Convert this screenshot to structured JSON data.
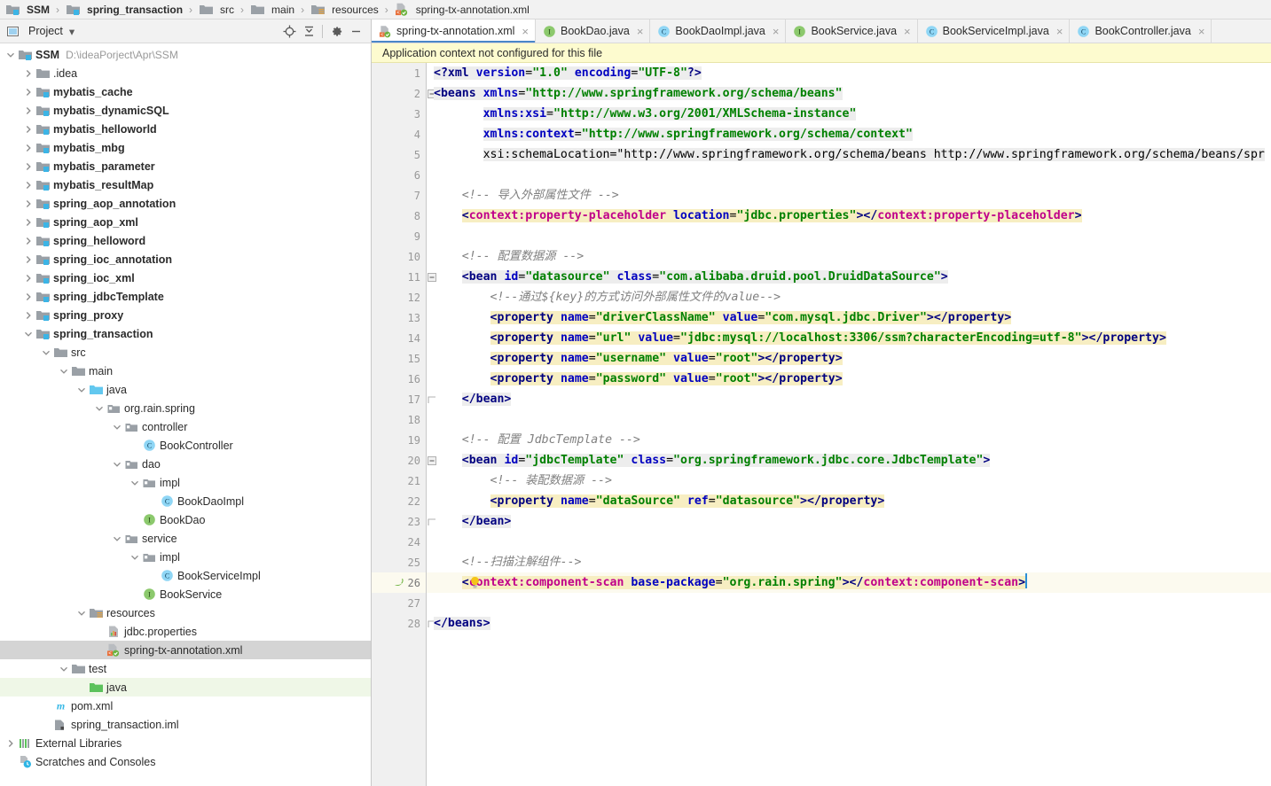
{
  "breadcrumb": {
    "items": [
      {
        "label": "SSM",
        "icon": "module-icon",
        "bold": true
      },
      {
        "label": "spring_transaction",
        "icon": "module-icon",
        "bold": true
      },
      {
        "label": "src",
        "icon": "folder-icon",
        "bold": false
      },
      {
        "label": "main",
        "icon": "folder-icon",
        "bold": false
      },
      {
        "label": "resources",
        "icon": "resources-folder-icon",
        "bold": false
      },
      {
        "label": "spring-tx-annotation.xml",
        "icon": "spring-xml-icon",
        "bold": false
      }
    ],
    "separator": "›"
  },
  "project_panel": {
    "title": "Project",
    "dropdown_caret": "▾",
    "toolbar_buttons": [
      {
        "name": "locate-icon",
        "tooltip": "Select Opened File"
      },
      {
        "name": "collapse-all-icon",
        "tooltip": "Collapse All"
      },
      {
        "name": "gear-icon",
        "tooltip": "Settings"
      },
      {
        "name": "minimize-icon",
        "tooltip": "Hide"
      }
    ],
    "tree": [
      {
        "indent": 0,
        "label": "SSM",
        "path": "D:\\ideaPorject\\Apr\\SSM",
        "icon": "module-icon",
        "arrow": "down",
        "bold": true
      },
      {
        "indent": 1,
        "label": ".idea",
        "icon": "folder-icon",
        "arrow": "right",
        "bold": false
      },
      {
        "indent": 1,
        "label": "mybatis_cache",
        "icon": "module-icon",
        "arrow": "right",
        "bold": true
      },
      {
        "indent": 1,
        "label": "mybatis_dynamicSQL",
        "icon": "module-icon",
        "arrow": "right",
        "bold": true
      },
      {
        "indent": 1,
        "label": "mybatis_helloworld",
        "icon": "module-icon",
        "arrow": "right",
        "bold": true
      },
      {
        "indent": 1,
        "label": "mybatis_mbg",
        "icon": "module-icon",
        "arrow": "right",
        "bold": true
      },
      {
        "indent": 1,
        "label": "mybatis_parameter",
        "icon": "module-icon",
        "arrow": "right",
        "bold": true
      },
      {
        "indent": 1,
        "label": "mybatis_resultMap",
        "icon": "module-icon",
        "arrow": "right",
        "bold": true
      },
      {
        "indent": 1,
        "label": "spring_aop_annotation",
        "icon": "module-icon",
        "arrow": "right",
        "bold": true
      },
      {
        "indent": 1,
        "label": "spring_aop_xml",
        "icon": "module-icon",
        "arrow": "right",
        "bold": true
      },
      {
        "indent": 1,
        "label": "spring_helloword",
        "icon": "module-icon",
        "arrow": "right",
        "bold": true
      },
      {
        "indent": 1,
        "label": "spring_ioc_annotation",
        "icon": "module-icon",
        "arrow": "right",
        "bold": true
      },
      {
        "indent": 1,
        "label": "spring_ioc_xml",
        "icon": "module-icon",
        "arrow": "right",
        "bold": true
      },
      {
        "indent": 1,
        "label": "spring_jdbcTemplate",
        "icon": "module-icon",
        "arrow": "right",
        "bold": true
      },
      {
        "indent": 1,
        "label": "spring_proxy",
        "icon": "module-icon",
        "arrow": "right",
        "bold": true
      },
      {
        "indent": 1,
        "label": "spring_transaction",
        "icon": "module-icon",
        "arrow": "down",
        "bold": true
      },
      {
        "indent": 2,
        "label": "src",
        "icon": "folder-icon",
        "arrow": "down",
        "bold": false
      },
      {
        "indent": 3,
        "label": "main",
        "icon": "folder-icon",
        "arrow": "down",
        "bold": false
      },
      {
        "indent": 4,
        "label": "java",
        "icon": "source-folder-icon",
        "arrow": "down",
        "bold": false
      },
      {
        "indent": 5,
        "label": "org.rain.spring",
        "icon": "package-icon",
        "arrow": "down",
        "bold": false
      },
      {
        "indent": 6,
        "label": "controller",
        "icon": "package-icon",
        "arrow": "down",
        "bold": false
      },
      {
        "indent": 7,
        "label": "BookController",
        "icon": "class-icon",
        "arrow": "none",
        "bold": false
      },
      {
        "indent": 6,
        "label": "dao",
        "icon": "package-icon",
        "arrow": "down",
        "bold": false
      },
      {
        "indent": 7,
        "label": "impl",
        "icon": "package-icon",
        "arrow": "down",
        "bold": false
      },
      {
        "indent": 8,
        "label": "BookDaoImpl",
        "icon": "class-icon",
        "arrow": "none",
        "bold": false
      },
      {
        "indent": 7,
        "label": "BookDao",
        "icon": "interface-icon",
        "arrow": "none",
        "bold": false
      },
      {
        "indent": 6,
        "label": "service",
        "icon": "package-icon",
        "arrow": "down",
        "bold": false
      },
      {
        "indent": 7,
        "label": "impl",
        "icon": "package-icon",
        "arrow": "down",
        "bold": false
      },
      {
        "indent": 8,
        "label": "BookServiceImpl",
        "icon": "class-icon",
        "arrow": "none",
        "bold": false
      },
      {
        "indent": 7,
        "label": "BookService",
        "icon": "interface-icon",
        "arrow": "none",
        "bold": false
      },
      {
        "indent": 4,
        "label": "resources",
        "icon": "resources-folder-icon",
        "arrow": "down",
        "bold": false
      },
      {
        "indent": 5,
        "label": "jdbc.properties",
        "icon": "properties-icon",
        "arrow": "none",
        "bold": false
      },
      {
        "indent": 5,
        "label": "spring-tx-annotation.xml",
        "icon": "spring-xml-icon",
        "arrow": "none",
        "bold": false,
        "state": "selected"
      },
      {
        "indent": 3,
        "label": "test",
        "icon": "folder-icon",
        "arrow": "down",
        "bold": false
      },
      {
        "indent": 4,
        "label": "java",
        "icon": "test-source-folder-icon",
        "arrow": "none",
        "bold": false,
        "state": "green"
      },
      {
        "indent": 2,
        "label": "pom.xml",
        "icon": "maven-icon",
        "arrow": "none",
        "bold": false
      },
      {
        "indent": 2,
        "label": "spring_transaction.iml",
        "icon": "iml-icon",
        "arrow": "none",
        "bold": false
      },
      {
        "indent": 0,
        "label": "External Libraries",
        "icon": "libraries-icon",
        "arrow": "right",
        "bold": false
      },
      {
        "indent": 0,
        "label": "Scratches and Consoles",
        "icon": "scratches-icon",
        "arrow": "none",
        "bold": false
      }
    ]
  },
  "editor": {
    "tabs": [
      {
        "label": "spring-tx-annotation.xml",
        "icon": "spring-xml-icon",
        "active": true,
        "close": "×"
      },
      {
        "label": "BookDao.java",
        "icon": "interface-icon",
        "active": false,
        "close": "×"
      },
      {
        "label": "BookDaoImpl.java",
        "icon": "class-icon",
        "active": false,
        "close": "×"
      },
      {
        "label": "BookService.java",
        "icon": "interface-icon",
        "active": false,
        "close": "×"
      },
      {
        "label": "BookServiceImpl.java",
        "icon": "class-icon",
        "active": false,
        "close": "×"
      },
      {
        "label": "BookController.java",
        "icon": "class-icon",
        "active": false,
        "close": "×"
      }
    ],
    "banner": "Application context not configured for this file",
    "current_line": 26,
    "total_lines": 28,
    "line_numbers": [
      1,
      2,
      3,
      4,
      5,
      6,
      7,
      8,
      9,
      10,
      11,
      12,
      13,
      14,
      15,
      16,
      17,
      18,
      19,
      20,
      21,
      22,
      23,
      24,
      25,
      26,
      27,
      28
    ],
    "code_lines": [
      {
        "n": 1,
        "text": "<?xml version=\"1.0\" encoding=\"UTF-8\"?>"
      },
      {
        "n": 2,
        "text": "<beans xmlns=\"http://www.springframework.org/schema/beans\""
      },
      {
        "n": 3,
        "text": "       xmlns:xsi=\"http://www.w3.org/2001/XMLSchema-instance\""
      },
      {
        "n": 4,
        "text": "       xmlns:context=\"http://www.springframework.org/schema/context\""
      },
      {
        "n": 5,
        "text": "       xsi:schemaLocation=\"http://www.springframework.org/schema/beans http://www.springframework.org/schema/beans/spr"
      },
      {
        "n": 6,
        "text": ""
      },
      {
        "n": 7,
        "text": "    <!-- 导入外部属性文件 -->"
      },
      {
        "n": 8,
        "text": "    <context:property-placeholder location=\"jdbc.properties\"></context:property-placeholder>"
      },
      {
        "n": 9,
        "text": ""
      },
      {
        "n": 10,
        "text": "    <!-- 配置数据源 -->"
      },
      {
        "n": 11,
        "text": "    <bean id=\"datasource\" class=\"com.alibaba.druid.pool.DruidDataSource\">"
      },
      {
        "n": 12,
        "text": "        <!--通过${key}的方式访问外部属性文件的value-->"
      },
      {
        "n": 13,
        "text": "        <property name=\"driverClassName\" value=\"com.mysql.jdbc.Driver\"></property>"
      },
      {
        "n": 14,
        "text": "        <property name=\"url\" value=\"jdbc:mysql://localhost:3306/ssm?characterEncoding=utf-8\"></property>"
      },
      {
        "n": 15,
        "text": "        <property name=\"username\" value=\"root\"></property>"
      },
      {
        "n": 16,
        "text": "        <property name=\"password\" value=\"root\"></property>"
      },
      {
        "n": 17,
        "text": "    </bean>"
      },
      {
        "n": 18,
        "text": ""
      },
      {
        "n": 19,
        "text": "    <!-- 配置 JdbcTemplate -->"
      },
      {
        "n": 20,
        "text": "    <bean id=\"jdbcTemplate\" class=\"org.springframework.jdbc.core.JdbcTemplate\">"
      },
      {
        "n": 21,
        "text": "        <!-- 装配数据源 -->"
      },
      {
        "n": 22,
        "text": "        <property name=\"dataSource\" ref=\"datasource\"></property>"
      },
      {
        "n": 23,
        "text": "    </bean>"
      },
      {
        "n": 24,
        "text": ""
      },
      {
        "n": 25,
        "text": "    <!--扫描注解组件-->"
      },
      {
        "n": 26,
        "text": "    <context:component-scan base-package=\"org.rain.spring\"></context:component-scan>"
      },
      {
        "n": 27,
        "text": ""
      },
      {
        "n": 28,
        "text": "</beans>"
      }
    ],
    "gutter_icons": [
      {
        "line": 26,
        "name": "spring-bean-gutter-icon"
      },
      {
        "line": 26,
        "name": "intention-bulb-icon"
      }
    ]
  },
  "colors": {
    "accent": "#4a86c8",
    "tag": "#000080",
    "attribute": "#0000c0",
    "value": "#008000",
    "namespace_tag": "#c0008a",
    "comment": "#808080",
    "banner_bg": "#fdfbcf",
    "selection_bg": "#d4d4d4",
    "current_line_bg": "#fcfaef",
    "highlight_yellow": "#f7eec2",
    "highlight_green": "#e8f5e3",
    "gutter_bg": "#f0f0f0"
  }
}
